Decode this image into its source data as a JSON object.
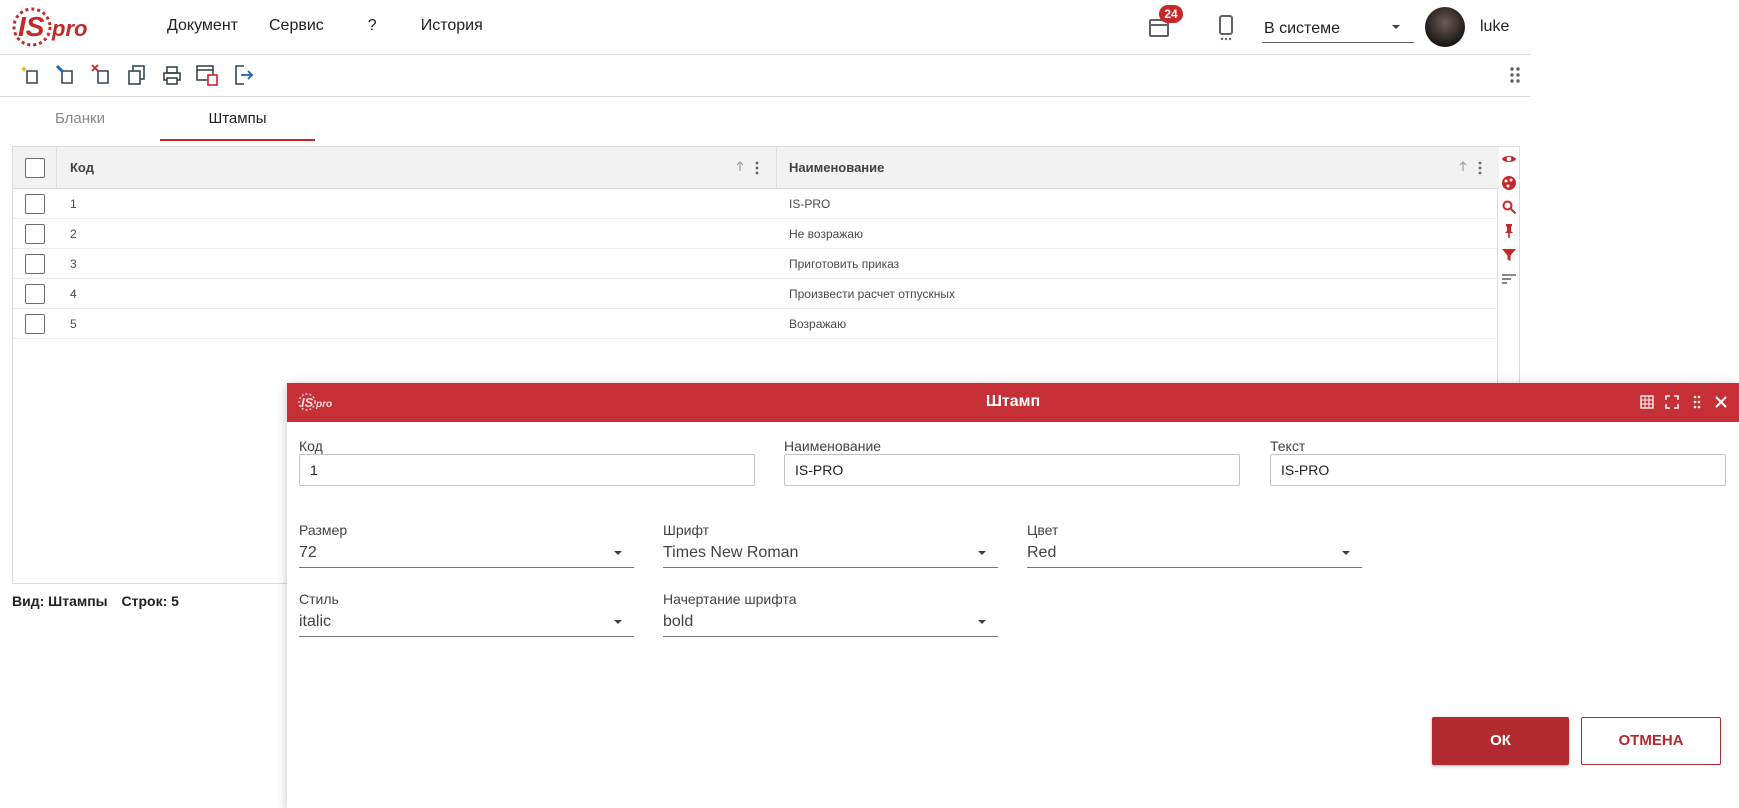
{
  "app": {
    "logo_text": "ISpro"
  },
  "menu": [
    "Документ",
    "Сервис",
    "?",
    "История"
  ],
  "header": {
    "notifications_count": "24",
    "status_value": "В системе",
    "username": "luke"
  },
  "colors": {
    "accent": "#c62f35",
    "button": "#b02a30"
  },
  "tabs": [
    {
      "label": "Бланки",
      "active": false
    },
    {
      "label": "Штампы",
      "active": true
    }
  ],
  "grid": {
    "columns": [
      "Код",
      "Наименование"
    ],
    "rows": [
      {
        "code": "1",
        "name": "IS-PRO"
      },
      {
        "code": "2",
        "name": "Не возражаю"
      },
      {
        "code": "3",
        "name": "Приготовить приказ"
      },
      {
        "code": "4",
        "name": "Произвести расчет отпускных"
      },
      {
        "code": "5",
        "name": "Возражаю"
      }
    ]
  },
  "footer": {
    "view": "Вид: Штампы",
    "rows": "Строк: 5"
  },
  "dialog": {
    "title": "Штамп",
    "fields": {
      "code": {
        "label": "Код",
        "value": "1"
      },
      "name": {
        "label": "Наименование",
        "value": "IS-PRO"
      },
      "text": {
        "label": "Текст",
        "value": "IS-PRO"
      },
      "size": {
        "label": "Размер",
        "value": "72"
      },
      "font": {
        "label": "Шрифт",
        "value": "Times New Roman"
      },
      "color": {
        "label": "Цвет",
        "value": "Red"
      },
      "style": {
        "label": "Стиль",
        "value": "italic"
      },
      "weight": {
        "label": "Начертание шрифта",
        "value": "bold"
      }
    },
    "ok_label": "ОК",
    "cancel_label": "ОТМЕНА"
  }
}
